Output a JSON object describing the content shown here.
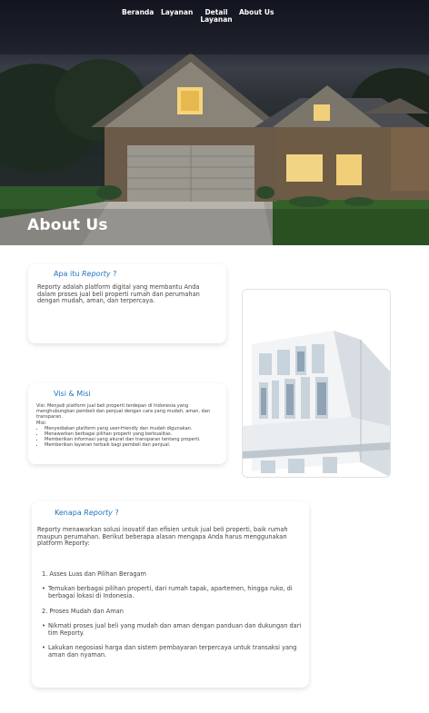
{
  "nav": {
    "items": [
      {
        "label": "Beranda"
      },
      {
        "label": "Layanan"
      },
      {
        "label": "Detail Layanan"
      },
      {
        "label": "About Us"
      }
    ]
  },
  "hero": {
    "title": "About Us"
  },
  "about": {
    "title_prefix": "Apa itu",
    "title_em": "Reporty",
    "title_suffix": "?",
    "body": "Reporty adalah platform digital yang membantu Anda dalam proses jual beli properti rumah dan perumahan dengan mudah, aman, dan terpercaya."
  },
  "vision": {
    "title": "Visi & Misi",
    "visi": "Visi: Menjadi platform jual beli properti terdepan di Indonesia yang menghubungkan pembeli dan penjual dengan cara yang mudah, aman, dan transparan.",
    "misi_label": "Misi:",
    "misi": [
      "Menyediakan platform yang user-friendly dan mudah digunakan.",
      "Menawarkan berbagai pilihan properti yang berkualitas.",
      "Memberikan informasi yang akurat dan transparan tentang properti.",
      "Memberikan layanan terbaik bagi pembeli dan penjual."
    ]
  },
  "why": {
    "title_prefix": "Kenapa",
    "title_em": "Reporty",
    "title_suffix": "?",
    "intro": "Reporty menawarkan solusi inovatif dan efisien untuk jual beli properti, baik rumah maupun perumahan. Berikut beberapa alasan mengapa Anda harus menggunakan platform Reporty:",
    "point1": "1. Asses Luas dan Pilihan Beragam",
    "point1_bullet": "Temukan berbagai pilihan properti, dari rumah tapak, apartemen, hingga ruko, di berbagai lokasi di Indonesia.",
    "point2": "2. Proses Mudah dan Aman",
    "point2_bullet1": "Nikmati proses jual beli yang mudah dan aman dengan panduan dan dukungan dari tim Reporty.",
    "point2_bullet2": "Lakukan negosiasi harga dan sistem pembayaran terpercaya untuk transaksi yang aman dan nyaman."
  },
  "colors": {
    "accent": "#1e73be",
    "hero_sky": "#262a35",
    "text": "#444444"
  }
}
